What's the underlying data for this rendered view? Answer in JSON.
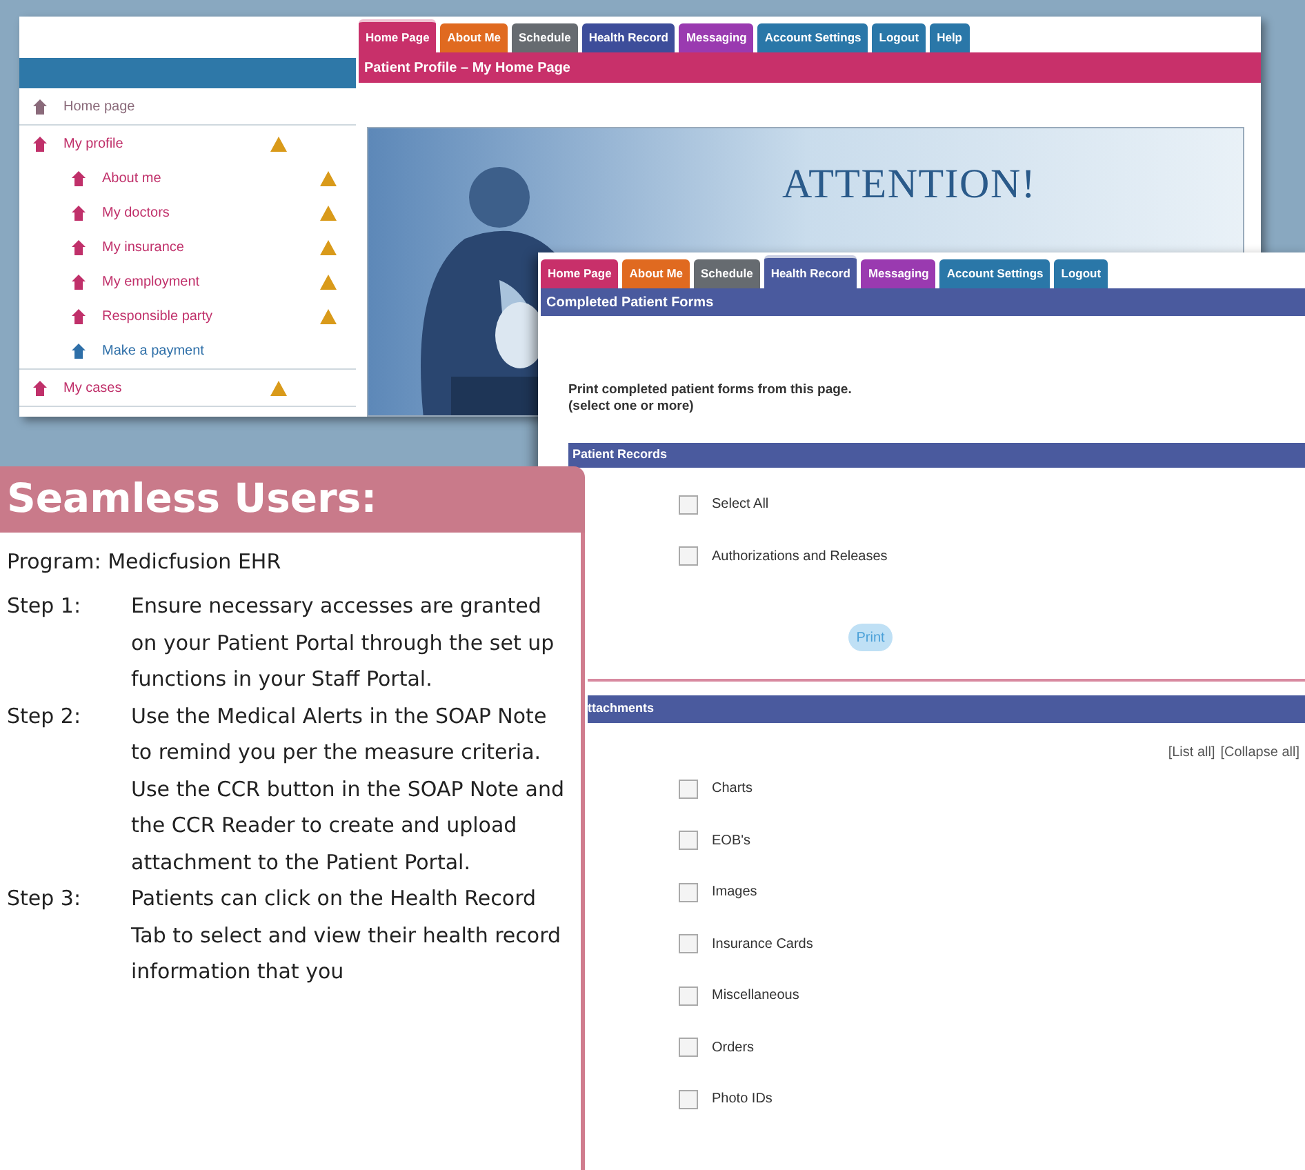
{
  "profile_window": {
    "tabs": [
      {
        "label": "Home Page",
        "color": "#c8306a",
        "selected": true
      },
      {
        "label": "About Me",
        "color": "#e06a20",
        "selected": false
      },
      {
        "label": "Schedule",
        "color": "#666b70",
        "selected": false
      },
      {
        "label": "Health Record",
        "color": "#3d4d9a",
        "selected": false
      },
      {
        "label": "Messaging",
        "color": "#9a3ab0",
        "selected": false
      },
      {
        "label": "Account Settings",
        "color": "#2a77a8",
        "selected": false
      },
      {
        "label": "Logout",
        "color": "#2a77a8",
        "selected": false
      },
      {
        "label": "Help",
        "color": "#2a77a8",
        "selected": false
      }
    ],
    "page_title": "Patient Profile – My Home Page",
    "sidebar": {
      "items": [
        {
          "label": "Home page",
          "warning": false,
          "kind": "plain"
        },
        {
          "label": "My profile",
          "warning": true,
          "kind": "alert",
          "children": [
            {
              "label": "About me",
              "warning": true,
              "kind": "alert"
            },
            {
              "label": "My doctors",
              "warning": true,
              "kind": "alert"
            },
            {
              "label": "My insurance",
              "warning": true,
              "kind": "alert"
            },
            {
              "label": "My employment",
              "warning": true,
              "kind": "alert"
            },
            {
              "label": "Responsible party",
              "warning": true,
              "kind": "alert"
            },
            {
              "label": "Make a payment",
              "warning": false,
              "kind": "action"
            }
          ]
        },
        {
          "label": "My cases",
          "warning": true,
          "kind": "alert"
        }
      ]
    },
    "banner": {
      "kind": "picture",
      "heading": "ATTENTION!"
    }
  },
  "forms_window": {
    "tabs": [
      {
        "label": "Home Page",
        "color": "#c8306a",
        "selected": false
      },
      {
        "label": "About Me",
        "color": "#e06a20",
        "selected": false
      },
      {
        "label": "Schedule",
        "color": "#666b70",
        "selected": false
      },
      {
        "label": "Health Record",
        "color": "#4a5a9e",
        "selected": true
      },
      {
        "label": "Messaging",
        "color": "#9a3ab0",
        "selected": false
      },
      {
        "label": "Account Settings",
        "color": "#2a77a8",
        "selected": false
      },
      {
        "label": "Logout",
        "color": "#2a77a8",
        "selected": false
      }
    ],
    "title": "Completed Patient Forms",
    "instructions": [
      "Print completed patient forms from this page.",
      "(select one or more)"
    ],
    "patient_records": {
      "heading": "Patient Records",
      "items": [
        {
          "label": "Select All",
          "checked": false
        },
        {
          "label": "Authorizations and Releases",
          "checked": false
        }
      ]
    },
    "print_button": "Print",
    "attachments": {
      "heading": "ttachments",
      "links": [
        "[List all]",
        "[Collapse all]"
      ],
      "items": [
        {
          "label": "Charts",
          "checked": false
        },
        {
          "label": "EOB's",
          "checked": false
        },
        {
          "label": "Images",
          "checked": false
        },
        {
          "label": "Insurance Cards",
          "checked": false
        },
        {
          "label": "Miscellaneous",
          "checked": false
        },
        {
          "label": "Orders",
          "checked": false
        },
        {
          "label": "Photo IDs",
          "checked": false
        }
      ]
    }
  },
  "info_panel": {
    "title": "Seamless Users:",
    "program": "Program: Medicfusion EHR",
    "steps": [
      {
        "label": "Step 1:",
        "text": "Ensure necessary accesses are granted on your Patient Portal through the set up functions in your Staff Portal."
      },
      {
        "label": "Step 2:",
        "text": "Use the Medical Alerts in the SOAP Note to remind you per the measure criteria. Use the CCR button in the SOAP Note and the CCR Reader to create and upload attachment to the Patient Portal."
      },
      {
        "label": "Step 3:",
        "text": "Patients can click on the Health Record Tab to select and view their health record information that you"
      }
    ]
  }
}
